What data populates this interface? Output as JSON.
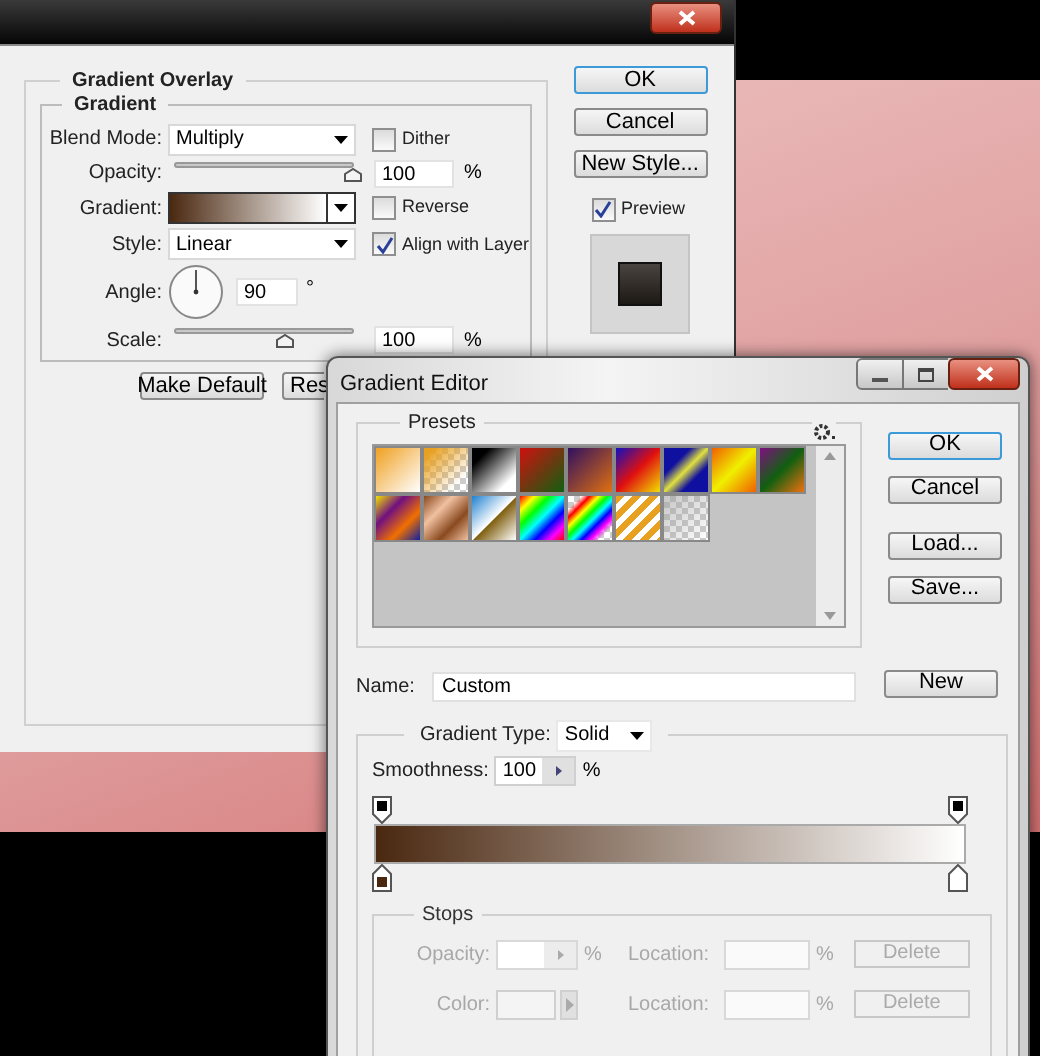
{
  "layer_style": {
    "section": "Gradient Overlay",
    "group": "Gradient",
    "blend_mode": {
      "label": "Blend Mode:",
      "value": "Multiply"
    },
    "dither": {
      "label": "Dither",
      "checked": false
    },
    "opacity": {
      "label": "Opacity:",
      "level": 1,
      "value": "100",
      "unit": "%"
    },
    "gradient": {
      "label": "Gradient:"
    },
    "reverse": {
      "label": "Reverse",
      "checked": false
    },
    "style": {
      "label": "Style:",
      "value": "Linear"
    },
    "align": {
      "label": "Align with Layer",
      "checked": true
    },
    "angle": {
      "label": "Angle:",
      "value": "90",
      "unit": "°"
    },
    "scale": {
      "label": "Scale:",
      "level": 0.62,
      "value": "100",
      "unit": "%"
    },
    "bottom_buttons": [
      "Make Default",
      "Res"
    ],
    "side_buttons": [
      {
        "label": "OK",
        "default": true
      },
      {
        "label": "Cancel",
        "default": false
      },
      {
        "label": "New Style...",
        "default": false
      }
    ],
    "preview": {
      "label": "Preview",
      "checked": true
    }
  },
  "gradient_editor": {
    "title": "Gradient Editor",
    "presets_label": "Presets",
    "buttons": [
      {
        "label": "OK",
        "default": true
      },
      {
        "label": "Cancel",
        "default": false
      },
      {
        "label": "Load...",
        "default": false
      },
      {
        "label": "Save...",
        "default": false
      }
    ],
    "name": {
      "label": "Name:",
      "value": "Custom"
    },
    "new_button": "New",
    "gradient_type": {
      "label": "Gradient Type:",
      "value": "Solid"
    },
    "smoothness": {
      "label": "Smoothness:",
      "value": "100",
      "unit": "%"
    },
    "color_stops": [
      {
        "color": "#4a2810"
      },
      {
        "color": "#ffffff"
      }
    ],
    "stops": {
      "label": "Stops",
      "disabled": true,
      "rows": [
        {
          "kind": "opacity",
          "label": "Opacity:",
          "unit": "%",
          "location_label": "Location:",
          "location_unit": "%",
          "button": "Delete"
        },
        {
          "kind": "color",
          "label": "Color:",
          "location_label": "Location:",
          "location_unit": "%",
          "button": "Delete"
        }
      ]
    }
  }
}
